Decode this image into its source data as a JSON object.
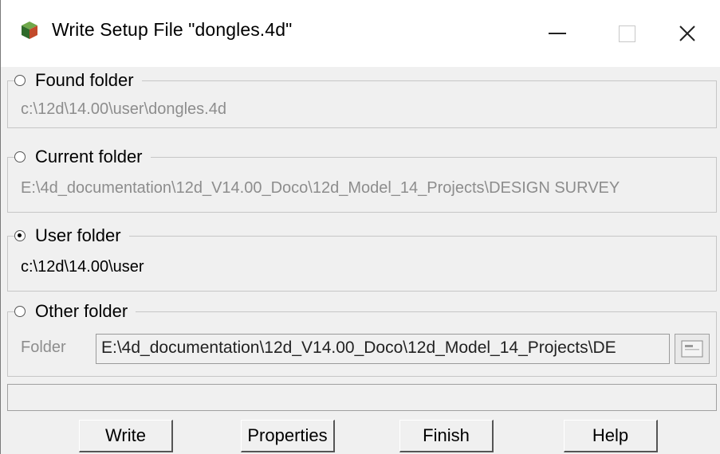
{
  "window": {
    "title": "Write Setup File \"dongles.4d\""
  },
  "groups": [
    {
      "label": "Found folder",
      "path": "c:\\12d\\14.00\\user\\dongles.4d",
      "selected": false
    },
    {
      "label": "Current folder",
      "path": "E:\\4d_documentation\\12d_V14.00_Doco\\12d_Model_14_Projects\\DESIGN SURVEY",
      "selected": false
    },
    {
      "label": "User folder",
      "path": "c:\\12d\\14.00\\user",
      "selected": true
    },
    {
      "label": "Other folder",
      "selected": false,
      "folder_label": "Folder",
      "folder_value": "E:\\4d_documentation\\12d_V14.00_Doco\\12d_Model_14_Projects\\DE"
    }
  ],
  "status_text": "",
  "buttons": {
    "write": "Write",
    "properties": "Properties",
    "finish": "Finish",
    "help": "Help"
  },
  "icons": {
    "app": "app-cube-icon",
    "minimize": "minimize-icon",
    "maximize": "maximize-icon",
    "close": "close-icon",
    "folder_browse": "folder-browse-icon"
  }
}
